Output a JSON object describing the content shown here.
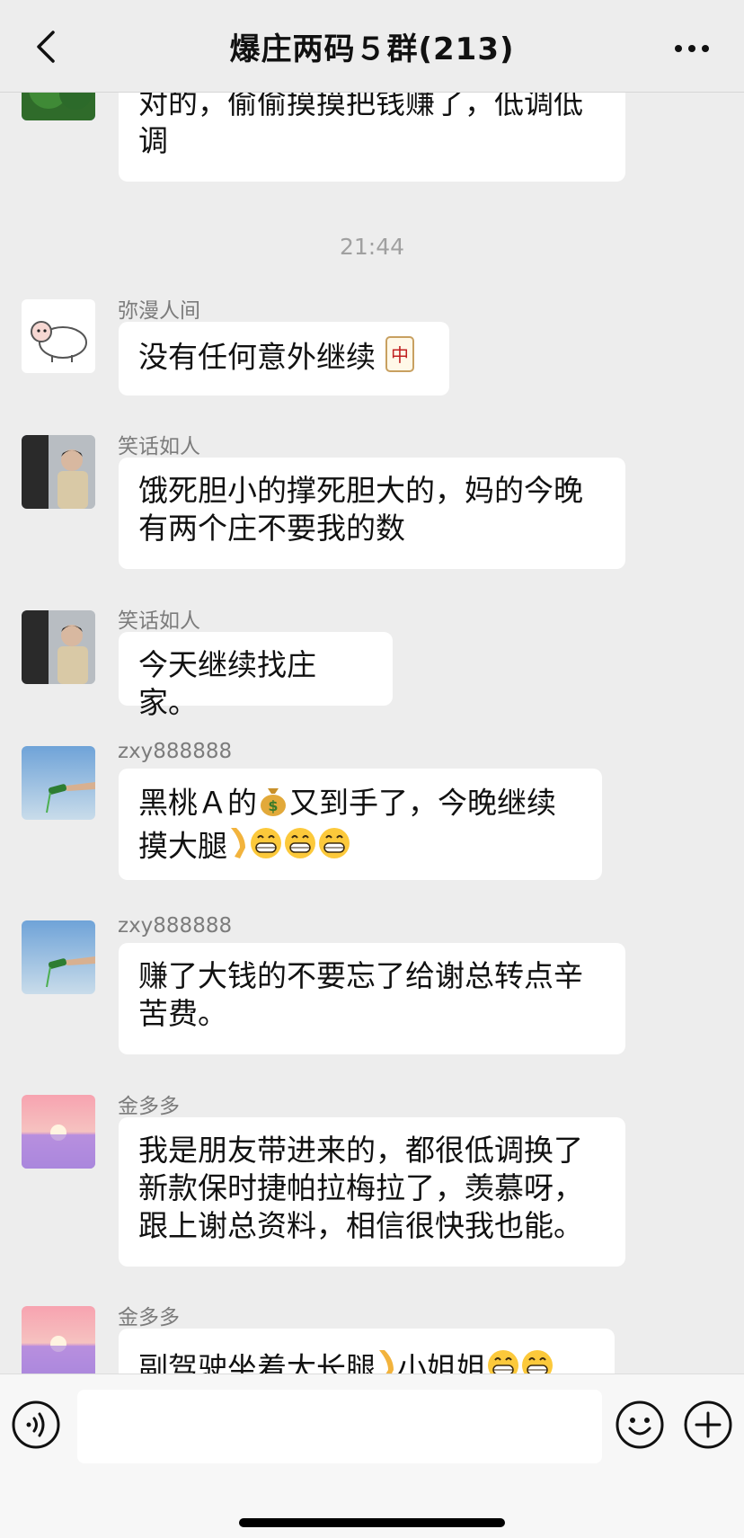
{
  "header": {
    "title": "爆庄两码５群(213)"
  },
  "messages": {
    "m0": {
      "text_line1": "对的，偷偷摸摸把钱赚了，低调低",
      "text_line2": "调"
    },
    "time": "21:44",
    "m1": {
      "sender": "弥漫人间",
      "text": "没有任何意外继续"
    },
    "m2": {
      "sender": "笑话如人",
      "text_line1": "饿死胆小的撑死胆大的，妈的今晚",
      "text_line2": "有两个庄不要我的数"
    },
    "m3": {
      "sender": "笑话如人",
      "text": "今天继续找庄家。"
    },
    "m4": {
      "sender": "zxy888888",
      "text_line1_a": "黑桃Ａ的",
      "text_line1_b": "又到手了，今晚继续",
      "text_line2": "摸大腿"
    },
    "m5": {
      "sender": "zxy888888",
      "text_line1": "赚了大钱的不要忘了给谢总转点辛",
      "text_line2": "苦费。"
    },
    "m6": {
      "sender": "金多多",
      "text_line1": "我是朋友带进来的，都很低调换了",
      "text_line2": "新款保时捷帕拉梅拉了，羡慕呀，",
      "text_line3": "跟上谢总资料，相信很快我也能。"
    },
    "m7": {
      "sender": "金多多",
      "text_a": "副驾驶坐着大长腿",
      "text_b": "小姐姐"
    }
  },
  "icons": {
    "back": "chevron-left-icon",
    "more": "more-dots-icon",
    "voice": "voice-icon",
    "emoji": "smiley-icon",
    "plus": "plus-circle-icon",
    "mahjong": "mahjong-red-dragon-emoji",
    "money_bag": "money-bag-emoji",
    "leg": "leg-emoji",
    "grin": "grinning-face-emoji"
  },
  "colors": {
    "background": "#ededed",
    "bubble": "#ffffff",
    "sender_name": "#7c7c7c",
    "timestamp": "#a0a0a0",
    "input_bar": "#f7f7f7"
  }
}
